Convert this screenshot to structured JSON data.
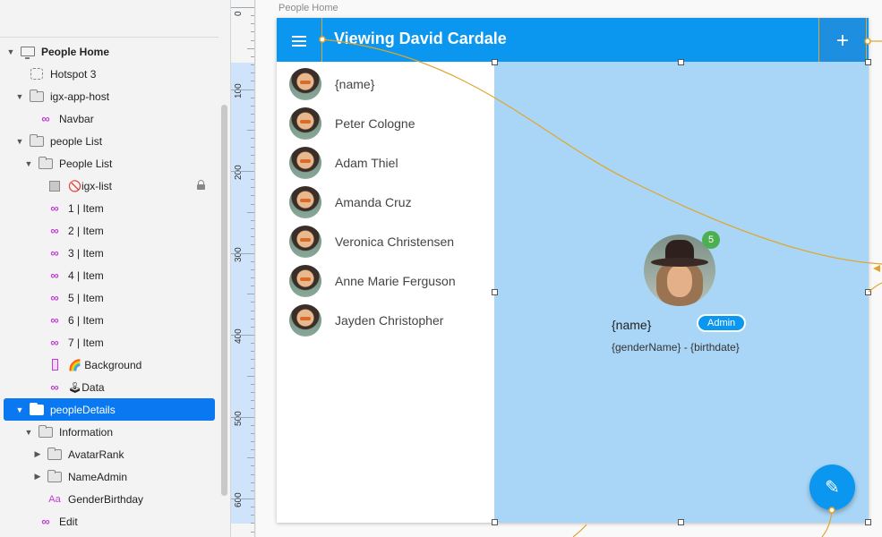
{
  "artboard_label": "People Home",
  "layers": [
    {
      "label": "People Home",
      "indent": 0,
      "icon": "monitor-icon",
      "bold": true,
      "expanded": true
    },
    {
      "label": "Hotspot 3",
      "indent": 1,
      "icon": "hotspot-icon"
    },
    {
      "label": "igx-app-host",
      "indent": 1,
      "icon": "folder-icon",
      "expanded": true
    },
    {
      "label": "Navbar",
      "indent": 2,
      "icon": "symbol-icon"
    },
    {
      "label": "people List",
      "indent": 1,
      "icon": "folder-icon",
      "expanded": true
    },
    {
      "label": "People List",
      "indent": 2,
      "icon": "folder-icon",
      "expanded": true
    },
    {
      "label": "🚫igx-list",
      "indent": 3,
      "icon": "rectangle-icon",
      "locked": true
    },
    {
      "label": "1 | Item",
      "indent": 3,
      "icon": "symbol-icon"
    },
    {
      "label": "2 | Item",
      "indent": 3,
      "icon": "symbol-icon"
    },
    {
      "label": "3 | Item",
      "indent": 3,
      "icon": "symbol-icon"
    },
    {
      "label": "4 | Item",
      "indent": 3,
      "icon": "symbol-icon"
    },
    {
      "label": "5 | Item",
      "indent": 3,
      "icon": "symbol-icon"
    },
    {
      "label": "6 | Item",
      "indent": 3,
      "icon": "symbol-icon"
    },
    {
      "label": "7 | Item",
      "indent": 3,
      "icon": "symbol-icon"
    },
    {
      "label": "🌈 Background",
      "indent": 3,
      "icon": "tall-rect-icon"
    },
    {
      "label": "🕹Data",
      "indent": 3,
      "icon": "symbol-icon"
    },
    {
      "label": "peopleDetails",
      "indent": 1,
      "icon": "folder-icon",
      "expanded": true,
      "selected": true
    },
    {
      "label": "Information",
      "indent": 2,
      "icon": "folder-icon",
      "expanded": true
    },
    {
      "label": "AvatarRank",
      "indent": 3,
      "icon": "folder-icon",
      "expanded": false
    },
    {
      "label": "NameAdmin",
      "indent": 3,
      "icon": "folder-icon",
      "expanded": false
    },
    {
      "label": "GenderBirthday",
      "indent": 3,
      "icon": "text-icon"
    },
    {
      "label": "Edit",
      "indent": 2,
      "icon": "symbol-icon"
    }
  ],
  "ruler": {
    "labels": [
      "0",
      "100",
      "200",
      "300",
      "400",
      "500",
      "600"
    ]
  },
  "navbar": {
    "title": "Viewing David Cardale",
    "menu_icon": "hamburger-menu-icon",
    "add_icon": "plus-icon",
    "add_glyph": "+"
  },
  "people": [
    "{name}",
    "Peter Cologne",
    "Adam Thiel",
    "Amanda Cruz",
    "Veronica Christensen",
    "Anne Marie Ferguson",
    "Jayden Christopher"
  ],
  "details": {
    "rank_badge": "5",
    "name": "{name}",
    "role_badge": "Admin",
    "subtitle": "{genderName} - {birthdate}"
  },
  "fab": {
    "icon": "pencil-edit-icon",
    "glyph": "✎"
  },
  "colors": {
    "primary": "#0b96f0",
    "details_bg": "#a9d6f7",
    "link_line": "#e0a52a",
    "selection": "#0a78f0",
    "badge_green": "#4caf50"
  }
}
